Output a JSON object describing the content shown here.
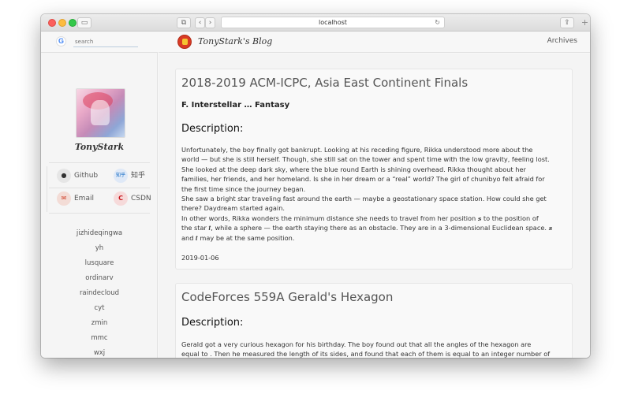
{
  "browser": {
    "url": "localhost",
    "back": "‹",
    "forward": "›",
    "reload": "↻",
    "new_tab": "+",
    "share": "⇪",
    "sidebar_toggle": "▭",
    "tabs": "⧉"
  },
  "sidebar": {
    "search_placeholder": "search",
    "google_letter": "G",
    "author": "TonyStark",
    "links": [
      {
        "label": "Github",
        "icon": "github-icon",
        "glyph": "●"
      },
      {
        "label": "知乎",
        "icon": "zhihu-icon",
        "glyph": "知乎"
      },
      {
        "label": "Email",
        "icon": "email-icon",
        "glyph": "✉"
      },
      {
        "label": "CSDN",
        "icon": "csdn-icon",
        "glyph": "C"
      }
    ],
    "friends": [
      "jizhideqingwa",
      "yh",
      "lusquare",
      "ordinarv",
      "raindecloud",
      "cyt",
      "zmin",
      "mmc",
      "wxj"
    ]
  },
  "nav": {
    "blog_title": "TonyStark's Blog",
    "archives": "Archives"
  },
  "posts": [
    {
      "title": "2018-2019 ACM-ICPC, Asia East Continent Finals",
      "subtitle": "F. Interstellar … Fantasy",
      "desc_heading": "Description:",
      "body": [
        "Unfortunately, the boy finally got bankrupt. Looking at his receding figure, Rikka understood more about the",
        "world — but she is still herself. Though, she still sat on the tower and spent time with the low gravity, feeling lost.",
        "She looked at the deep dark sky, where the blue round Earth is shining overhead. Rikka thought about her",
        "families, her friends, and her homeland. Is she in her dream or a “real” world? The girl of chunibyo felt afraid for",
        "the first time since the journey began.",
        "She saw a bright star traveling fast around the earth — maybe a geostationary space station. How could she get",
        "there? Daydream started again.",
        "In other words, Rikka wonders the minimum distance she needs to travel from her position 𝒔 to the position of",
        "the star 𝒕, while a sphere — the earth staying there as an obstacle. They are in a 3-dimensional Euclidean space. 𝒔",
        "and 𝒕 may be at the same position."
      ],
      "date": "2019-01-06"
    },
    {
      "title": "CodeForces 559A Gerald's Hexagon",
      "desc_heading": "Description:",
      "body": [
        "Gerald got a very curious hexagon for his birthday. The boy found out that all the angles of the hexagon are",
        "equal to . Then he measured the length of its sides, and found that each of them is equal to an integer number of"
      ]
    }
  ]
}
